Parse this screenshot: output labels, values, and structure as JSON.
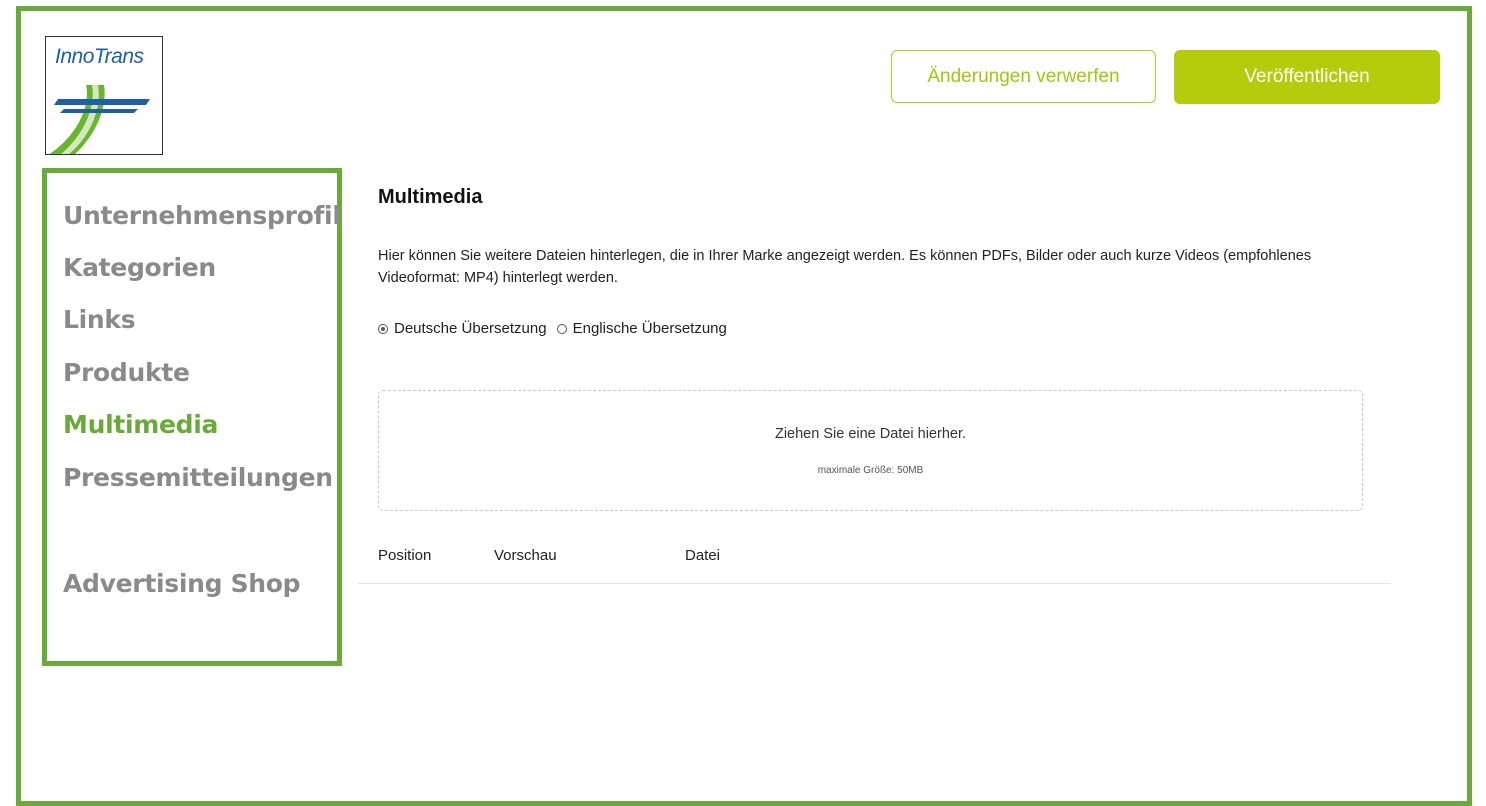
{
  "app": {
    "logo_text": "InnoTrans"
  },
  "header": {
    "discard_label": "Änderungen verwerfen",
    "publish_label": "Veröffentlichen"
  },
  "sidebar": {
    "items": [
      {
        "label": "Unternehmensprofil",
        "active": false
      },
      {
        "label": "Kategorien",
        "active": false
      },
      {
        "label": "Links",
        "active": false
      },
      {
        "label": "Produkte",
        "active": false
      },
      {
        "label": "Multimedia",
        "active": true
      },
      {
        "label": "Pressemitteilungen",
        "active": false
      },
      {
        "label": "Advertising Shop",
        "active": false
      }
    ]
  },
  "main": {
    "title": "Multimedia",
    "description": "Hier können Sie weitere Dateien hinterlegen, die in Ihrer Marke angezeigt werden. Es können PDFs, Bilder oder auch kurze Videos (empfohlenes Videoformat: MP4) hinterlegt werden.",
    "language_options": [
      {
        "label": "Deutsche Übersetzung",
        "checked": true
      },
      {
        "label": "Englische Übersetzung",
        "checked": false
      }
    ],
    "dropzone": {
      "title": "Ziehen Sie eine Datei hierher.",
      "subtitle": "maximale Größe: 50MB"
    },
    "table": {
      "columns": [
        "Position",
        "Vorschau",
        "Datei"
      ]
    }
  },
  "colors": {
    "frame_green": "#6aaa3a",
    "accent_lime": "#b5cc0c",
    "nav_gray": "#8a8a8a"
  }
}
